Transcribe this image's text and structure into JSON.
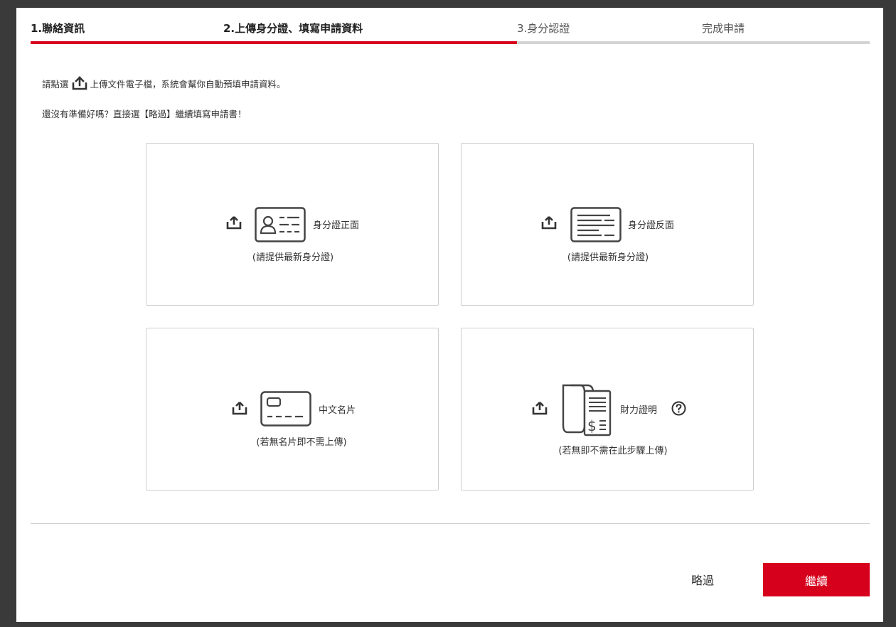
{
  "steps": [
    {
      "label": "1.聯絡資訊",
      "state": "done"
    },
    {
      "label": "2.上傳身分證、填寫申請資料",
      "state": "active"
    },
    {
      "label": "3.身分認證",
      "state": "pending"
    },
    {
      "label": "完成申請",
      "state": "pending"
    }
  ],
  "progress_fraction": 0.58,
  "intro": {
    "line1_prefix": "請點選",
    "line1_suffix": "上傳文件電子檔，系統會幫你自動預填申請資料。",
    "line2": "還沒有準備好嗎？直接選【略過】繼續填寫申請書！"
  },
  "cards": [
    {
      "label": "身分證正面",
      "hint": "(請提供最新身分證)",
      "icon": "id-card-front-icon"
    },
    {
      "label": "身分證反面",
      "hint": "(請提供最新身分證)",
      "icon": "id-card-back-icon"
    },
    {
      "label": "中文名片",
      "hint": "(若無名片即不需上傳)",
      "icon": "business-card-icon"
    },
    {
      "label": "財力證明",
      "hint": "(若無即不需在此步驟上傳)",
      "icon": "financial-document-icon"
    }
  ],
  "buttons": {
    "skip": "略過",
    "continue": "繼續"
  },
  "colors": {
    "accent": "#d6001c",
    "track": "#d3d3d3",
    "border": "#cfcfcf"
  }
}
